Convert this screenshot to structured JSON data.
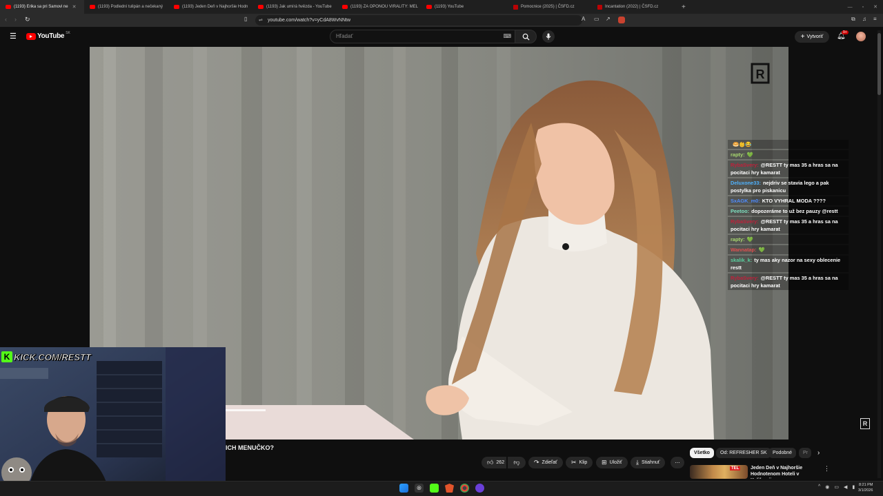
{
  "browser": {
    "tabs": [
      {
        "title": "(1193) Erika sa pri Samovi ne",
        "active": true
      },
      {
        "title": "(1193) Podlední tulipán a nečekaný"
      },
      {
        "title": "(1193) Jeden Deň v Najhoršie Hodn"
      },
      {
        "title": "(1193) Jak umírá hvězda - YouTube"
      },
      {
        "title": "(1193) ZA OPONOU VIRALITY: MEL"
      },
      {
        "title": "(1193) YouTube"
      },
      {
        "title": "Pomocnice (2025) | ČSFD.cz",
        "favicon": "csfd"
      },
      {
        "title": "Incantation (2022) | ČSFD.cz",
        "favicon": "csfd"
      }
    ],
    "url": "youtube.com/watch?v=yCdA8WvNNtw"
  },
  "youtube": {
    "logo_text": "YouTube",
    "country_code": "SK",
    "search_placeholder": "Hľadať",
    "create_label": "Vytvoriť",
    "notification_count": "9+"
  },
  "video": {
    "caption_fragment": "ICH MENUČKO?",
    "likes": "262",
    "share_label": "Zdieľať",
    "clip_label": "Klip",
    "save_label": "Uložiť",
    "download_label": "Stiahnuť",
    "watermark": "R"
  },
  "overlay": {
    "kick_label": "KICK.COM/RESTT"
  },
  "chat": [
    {
      "user": "",
      "user_color": "#ffffff",
      "text": "🥯👶😂"
    },
    {
      "user": "rapty:",
      "user_color": "#a8d86f",
      "text": "💚"
    },
    {
      "user": "RybaSvery:",
      "user_color": "#c0203a",
      "text": "@RESTT ty mas 35 a hras sa na pocitaci hry kamarat"
    },
    {
      "user": "Deluxone33:",
      "user_color": "#4fb3ff",
      "text": "nejdriv se stavia lego a pak postylka pro piskanicu"
    },
    {
      "user": "SxAGK_m0:",
      "user_color": "#4f8cff",
      "text": "KTO VYHRAL MODA ????"
    },
    {
      "user": "Peetoo:",
      "user_color": "#7de0c0",
      "text": "dopozeráme to už bez pauzy @restt"
    },
    {
      "user": "RybaSvery:",
      "user_color": "#c0203a",
      "text": "@RESTT ty mas 35 a hras sa na pocitaci hry kamarat"
    },
    {
      "user": "rapty:",
      "user_color": "#a8d86f",
      "text": "💚"
    },
    {
      "user": "Wannatap:",
      "user_color": "#e05050",
      "text": "💚"
    },
    {
      "user": "skalik_k:",
      "user_color": "#5ad0a0",
      "text": "ty mas aky nazor na sexy oblecenie restt"
    },
    {
      "user": "RybaSvery:",
      "user_color": "#c0203a",
      "text": "@RESTT ty mas 35 a hras sa na pocitaci hry kamarat"
    }
  ],
  "sidebar": {
    "chips": [
      "Všetko",
      "Od: REFRESHER SK",
      "Podobné",
      "Pr"
    ],
    "next_video": {
      "title": "Jeden Deň v Najhoršie Hodnotenom Hoteli v Kalifornii"
    }
  },
  "taskbar": {
    "time": "8:21 PM",
    "date": "3/1/2026"
  },
  "colors": {
    "youtube_red": "#ff0000",
    "kick_green": "#53fc18",
    "background": "#0f0f0f"
  }
}
